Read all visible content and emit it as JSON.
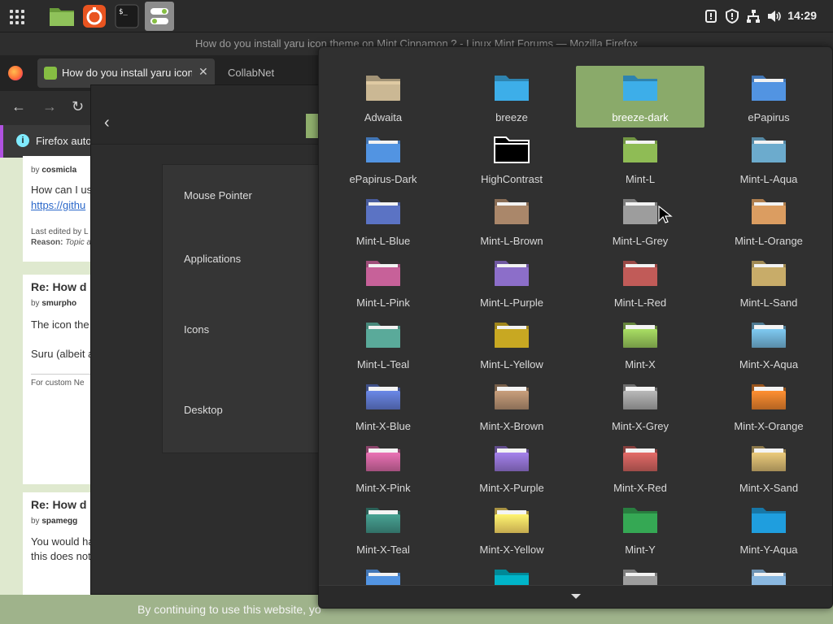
{
  "panel": {
    "clock": "14:29",
    "launchers": [
      "apps-menu",
      "files",
      "firefox",
      "terminal",
      "settings"
    ]
  },
  "firefox": {
    "window_title": "How do you install yaru icon theme on Mint Cinnamon ? - Linux Mint Forums — Mozilla Firefox",
    "tabs": [
      {
        "label": "How do you install yaru icon theme on Mint Cinnamon ?",
        "active": true
      },
      {
        "label": "CollabNet",
        "active": false
      }
    ],
    "notification": "Firefox auto",
    "cookie_text": "By continuing to use this website, yo"
  },
  "forum": {
    "post1": {
      "by_prefix": "by",
      "author": "cosmicla",
      "text": "How can I us",
      "link": "https://githu",
      "edited": "Last edited by L",
      "reason_label": "Reason:",
      "reason": "Topic a"
    },
    "post2": {
      "title": "Re: How d",
      "by_prefix": "by",
      "author": "smurpho",
      "text1": "The icon the",
      "text2": "Suru (albeit a",
      "signature": "For custom Ne"
    },
    "post3": {
      "title": "Re: How d",
      "by_prefix": "by",
      "author": "spamegg",
      "text1": "You would ha",
      "text2": "this does not"
    }
  },
  "themes_window": {
    "settings": [
      "Mouse Pointer",
      "Applications",
      "Icons",
      "Desktop"
    ]
  },
  "icon_chooser": {
    "selected": "breeze-dark",
    "items": [
      {
        "name": "Adwaita",
        "color": "#cbb894",
        "style": "adwaita"
      },
      {
        "name": "breeze",
        "color": "#3daee9",
        "style": "flat"
      },
      {
        "name": "breeze-dark",
        "color": "#3daee9",
        "style": "flat"
      },
      {
        "name": "ePapirus",
        "color": "#5294e2",
        "style": "paper"
      },
      {
        "name": "ePapirus-Dark",
        "color": "#5294e2",
        "style": "paper"
      },
      {
        "name": "HighContrast",
        "color": "#000000",
        "style": "contrast"
      },
      {
        "name": "Mint-L",
        "color": "#8fbc55",
        "style": "paper"
      },
      {
        "name": "Mint-L-Aqua",
        "color": "#6cabcd",
        "style": "paper"
      },
      {
        "name": "Mint-L-Blue",
        "color": "#5b73c4",
        "style": "paper"
      },
      {
        "name": "Mint-L-Brown",
        "color": "#aa876a",
        "style": "paper"
      },
      {
        "name": "Mint-L-Grey",
        "color": "#9d9d9d",
        "style": "paper"
      },
      {
        "name": "Mint-L-Orange",
        "color": "#db9d61",
        "style": "paper"
      },
      {
        "name": "Mint-L-Pink",
        "color": "#c76199",
        "style": "paper"
      },
      {
        "name": "Mint-L-Purple",
        "color": "#8c6ec9",
        "style": "paper"
      },
      {
        "name": "Mint-L-Red",
        "color": "#c15b58",
        "style": "paper"
      },
      {
        "name": "Mint-L-Sand",
        "color": "#c8ac69",
        "style": "paper"
      },
      {
        "name": "Mint-L-Teal",
        "color": "#5aaa9a",
        "style": "paper"
      },
      {
        "name": "Mint-L-Yellow",
        "color": "#c8a822",
        "style": "paper"
      },
      {
        "name": "Mint-X",
        "color": "#8fbc55",
        "style": "glossy"
      },
      {
        "name": "Mint-X-Aqua",
        "color": "#6cabcd",
        "style": "glossy"
      },
      {
        "name": "Mint-X-Blue",
        "color": "#5b73c4",
        "style": "glossy"
      },
      {
        "name": "Mint-X-Brown",
        "color": "#aa876a",
        "style": "glossy"
      },
      {
        "name": "Mint-X-Grey",
        "color": "#9d9d9d",
        "style": "glossy"
      },
      {
        "name": "Mint-X-Orange",
        "color": "#db7a2a",
        "style": "glossy"
      },
      {
        "name": "Mint-X-Pink",
        "color": "#c76199",
        "style": "glossy"
      },
      {
        "name": "Mint-X-Purple",
        "color": "#8c6ec9",
        "style": "glossy"
      },
      {
        "name": "Mint-X-Red",
        "color": "#c15b58",
        "style": "glossy"
      },
      {
        "name": "Mint-X-Sand",
        "color": "#c8ac69",
        "style": "glossy"
      },
      {
        "name": "Mint-X-Teal",
        "color": "#3d8a7d",
        "style": "glossy"
      },
      {
        "name": "Mint-X-Yellow",
        "color": "#f0d060",
        "style": "glossy"
      },
      {
        "name": "Mint-Y",
        "color": "#35a854",
        "style": "flat"
      },
      {
        "name": "Mint-Y-Aqua",
        "color": "#1f9ede",
        "style": "flat"
      },
      {
        "name": "",
        "color": "#5294e2",
        "style": "paper"
      },
      {
        "name": "",
        "color": "#00b5c9",
        "style": "flat"
      },
      {
        "name": "",
        "color": "#9d9d9d",
        "style": "paper"
      },
      {
        "name": "",
        "color": "#8ab8e0",
        "style": "paper"
      }
    ]
  },
  "colors": {
    "accent": "#8aaa6a",
    "panel_bg": "#2b2b2b",
    "chooser_bg": "#303030",
    "forum_bg": "#dfe9cf"
  }
}
